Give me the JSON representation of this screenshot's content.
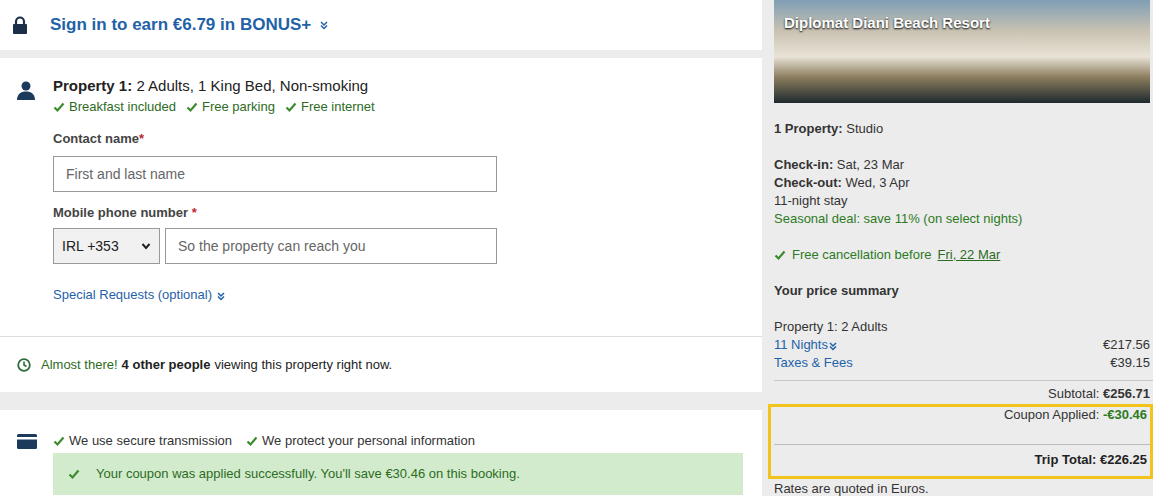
{
  "signin": {
    "text": "Sign in to earn €6.79 in BONUS+"
  },
  "room": {
    "label": "Property 1:",
    "details": "2 Adults, 1 King Bed, Non-smoking",
    "amenities": [
      "Breakfast included",
      "Free parking",
      "Free internet"
    ]
  },
  "form": {
    "contact": {
      "label": "Contact name",
      "required": "*",
      "placeholder": "First and last name"
    },
    "phone": {
      "label": "Mobile phone number",
      "required": "*",
      "country": "IRL +353",
      "placeholder": "So the property can reach you"
    },
    "special_requests": "Special Requests (optional)"
  },
  "urgency": {
    "lead": "Almost there!",
    "count": "4 other people",
    "rest": "viewing this property right now."
  },
  "security": [
    "We use secure transmission",
    "We protect your personal information"
  ],
  "coupon_message": "Your coupon was applied successfully. You'll save €30.46 on this booking.",
  "summary": {
    "hotel": "Diplomat Diani Beach Resort",
    "property": {
      "label": "1 Property:",
      "value": "Studio"
    },
    "check_in": {
      "label": "Check-in:",
      "value": "Sat, 23 Mar"
    },
    "check_out": {
      "label": "Check-out:",
      "value": "Wed, 3 Apr"
    },
    "stay": "11-night stay",
    "deal": "Seasonal deal: save 11% (on select nights)",
    "cancellation": {
      "text": "Free cancellation before",
      "date": "Fri, 22 Mar"
    },
    "price_title": "Your price summary",
    "guests": "Property 1: 2 Adults",
    "lines": [
      {
        "label": "11 Nights",
        "value": "€217.56",
        "expandable": true
      },
      {
        "label": "Taxes & Fees",
        "value": "€39.15",
        "expandable": false
      }
    ],
    "subtotal": {
      "label": "Subtotal:",
      "value": "€256.71"
    },
    "coupon": {
      "label": "Coupon Applied:",
      "value": "-€30.46"
    },
    "total": {
      "label": "Trip Total:",
      "value": "€226.25"
    },
    "highlighted": true,
    "note": "Rates are quoted in Euros."
  }
}
